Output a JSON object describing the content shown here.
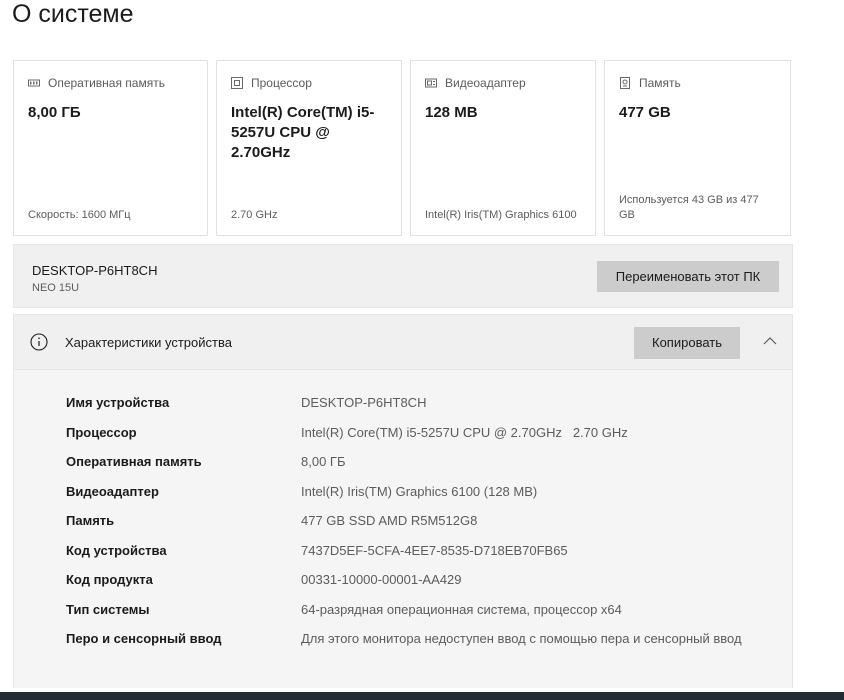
{
  "page": {
    "title": "О системе"
  },
  "cards": [
    {
      "icon": "memory-icon",
      "label": "Оперативная память",
      "value": "8,00 ГБ",
      "foot": "Скорость: 1600 МГц"
    },
    {
      "icon": "processor-icon",
      "label": "Процессор",
      "value": "Intel(R) Core(TM) i5-5257U CPU @ 2.70GHz",
      "foot": "2.70 GHz"
    },
    {
      "icon": "video-adapter-icon",
      "label": "Видеоадаптер",
      "value": "128 MB",
      "foot": "Intel(R) Iris(TM) Graphics 6100"
    },
    {
      "icon": "storage-icon",
      "label": "Память",
      "value": "477 GB",
      "foot": "Используется 43 GB из 477 GB"
    }
  ],
  "device": {
    "name": "DESKTOP-P6HT8CH",
    "model": "NEO 15U",
    "rename_label": "Переименовать этот ПК"
  },
  "specs": {
    "title": "Характеристики устройства",
    "copy_label": "Копировать",
    "rows": [
      {
        "label": "Имя устройства",
        "value": "DESKTOP-P6HT8CH"
      },
      {
        "label": "Процессор",
        "value": "Intel(R) Core(TM) i5-5257U CPU @ 2.70GHz   2.70 GHz"
      },
      {
        "label": "Оперативная память",
        "value": "8,00 ГБ"
      },
      {
        "label": "Видеоадаптер",
        "value": "Intel(R) Iris(TM) Graphics 6100 (128 MB)"
      },
      {
        "label": "Память",
        "value": "477 GB SSD AMD R5M512G8"
      },
      {
        "label": "Код устройства",
        "value": "7437D5EF-5CFA-4EE7-8535-D718EB70FB65"
      },
      {
        "label": "Код продукта",
        "value": "00331-10000-00001-AA429"
      },
      {
        "label": "Тип системы",
        "value": "64-разрядная операционная система, процессор x64"
      },
      {
        "label": "Перо и сенсорный ввод",
        "value": "Для этого монитора недоступен ввод с помощью пера и сенсорный ввод"
      }
    ]
  }
}
